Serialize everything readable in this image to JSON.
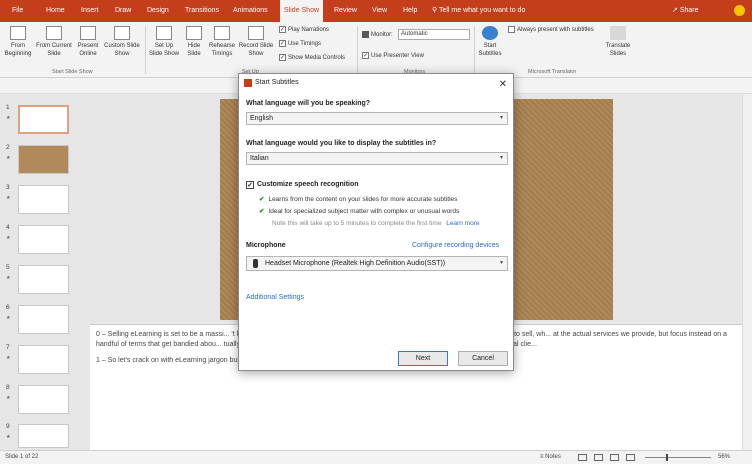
{
  "tabs": [
    "File",
    "Home",
    "Insert",
    "Draw",
    "Design",
    "Transitions",
    "Animations",
    "Slide Show",
    "Review",
    "View",
    "Help"
  ],
  "active_tab": "Slide Show",
  "tell_me": "Tell me what you want to do",
  "share": "Share",
  "ribbon": {
    "from_beginning": "From Beginning",
    "from_current": "From Current Slide",
    "present_online": "Present Online",
    "custom_show": "Custom Slide Show",
    "set_up": "Set Up Slide Show",
    "hide": "Hide Slide",
    "rehearse": "Rehearse Timings",
    "record": "Record Slide Show",
    "play_narrations": "Play Narrations",
    "use_timings": "Use Timings",
    "show_media": "Show Media Controls",
    "monitor_label": "Monitor:",
    "monitor_value": "Automatic",
    "presenter_view": "Use Presenter View",
    "start_subtitles": "Start Subtitles",
    "always_present": "Always present with subtitles",
    "translate_slides": "Translate Slides",
    "grp_start": "Start Slide Show",
    "grp_setup": "Set Up",
    "grp_monitors": "Monitors",
    "grp_translator": "Microsoft Translator"
  },
  "thumbnails": [
    "1",
    "2",
    "3",
    "4",
    "5",
    "6",
    "7",
    "8",
    "9"
  ],
  "notes": {
    "p1": "0 – Selling eLearning is set to be a massi...                                              't know a great deal about it. We're in the process of working out exactly what we are going to sell, wh...                                         at the actual services we provide, but focus instead on a handful of terms that get bandied abou...                                        tually means, so that hopefully we can all have an intelligent conversation about it with potential clie...",
    "p2": "1 – So let's crack on with eLearning jargon busters, or, #whatisSCORM."
  },
  "status": {
    "slide_of": "Slide 1 of 22",
    "notes": "Notes",
    "zoom": "56%"
  },
  "dialog": {
    "title": "Start Subtitles",
    "q_speak": "What language will you be speaking?",
    "speak_value": "English",
    "q_display": "What language would you like to display the subtitles in?",
    "display_value": "Italian",
    "customize": "Customize speech recognition",
    "bullet1": "Learns from the content on your slides for more accurate subtitles",
    "bullet2": "Ideal for specialized subject matter with complex or unusual words",
    "note": "Note this will take up to 5 minutes to complete the first time",
    "learn_more": "Learn more",
    "microphone_label": "Microphone",
    "configure": "Configure recording devices",
    "mic_value": "Headset Microphone (Realtek High Definition Audio(SST))",
    "additional": "Additional Settings",
    "next": "Next",
    "cancel": "Cancel"
  }
}
